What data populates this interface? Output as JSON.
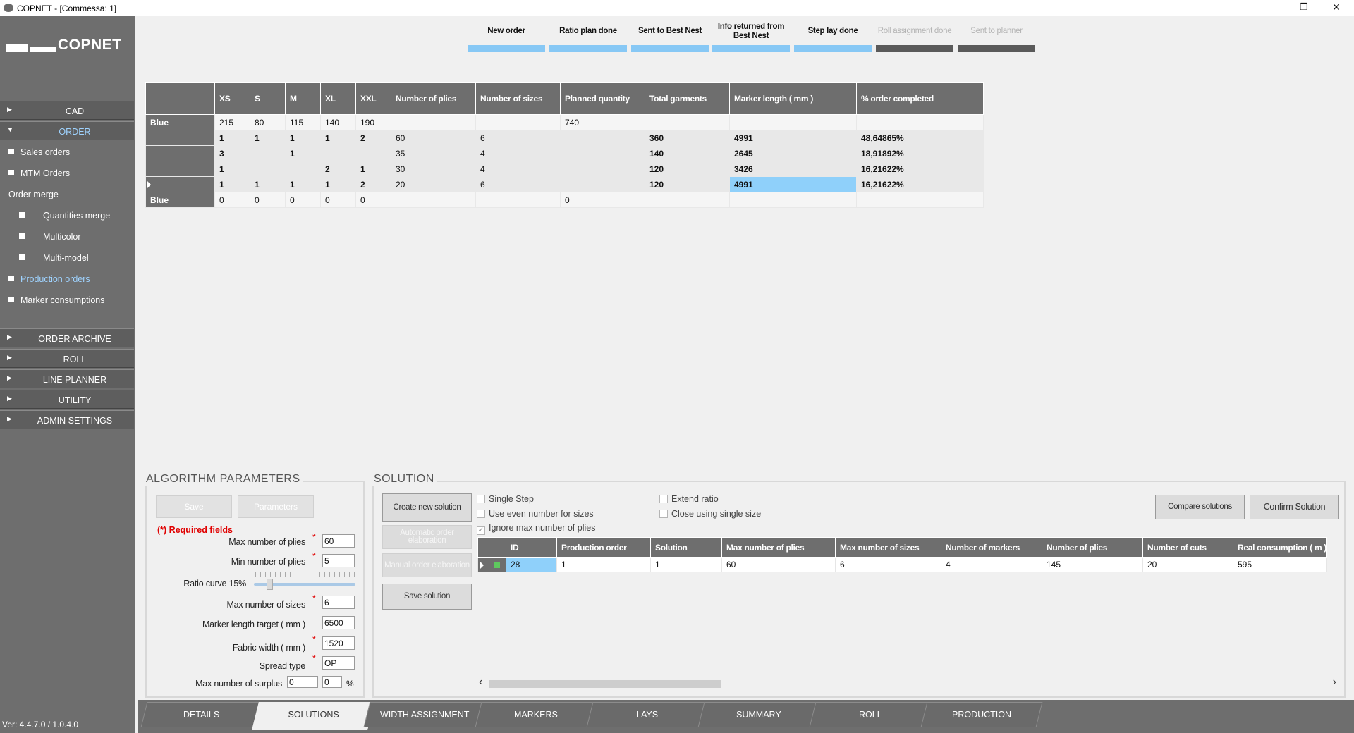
{
  "window": {
    "title": "COPNET - [Commessa: 1]",
    "minimize_icon": "minimize-icon",
    "maximize_icon": "restore-icon",
    "close_icon": "close-icon",
    "minimize_glyph": "—",
    "restore_glyph": "❐",
    "close_glyph": "✕"
  },
  "sidebar": {
    "logo_text": "COPNET",
    "sections_top": [
      {
        "label": "CAD",
        "expanded": false
      },
      {
        "label": "ORDER",
        "expanded": true
      }
    ],
    "order_items": [
      {
        "label": "Sales orders"
      },
      {
        "label": "MTM Orders"
      },
      {
        "label": "Order merge"
      },
      {
        "label": "Quantities merge"
      },
      {
        "label": "Multicolor"
      },
      {
        "label": "Multi-model"
      },
      {
        "label": "Production orders",
        "highlighted": true
      },
      {
        "label": "Marker consumptions"
      }
    ],
    "sections_bottom": [
      {
        "label": "ORDER ARCHIVE"
      },
      {
        "label": "ROLL"
      },
      {
        "label": "LINE PLANNER"
      },
      {
        "label": "UTILITY"
      },
      {
        "label": "ADMIN SETTINGS"
      }
    ],
    "arrow_right": "▶",
    "arrow_down": "▼",
    "version": "Ver: 4.4.7.0 / 1.0.4.0"
  },
  "steps": [
    {
      "label": "New order",
      "done": true
    },
    {
      "label": "Ratio plan done",
      "done": true
    },
    {
      "label": "Sent to Best Nest",
      "done": true
    },
    {
      "label": "Info returned from Best Nest",
      "done": true
    },
    {
      "label": "Step lay done",
      "done": true
    },
    {
      "label": "Roll assignment done",
      "done": false
    },
    {
      "label": "Sent to planner",
      "done": false
    }
  ],
  "order_grid": {
    "columns": [
      "",
      "XS",
      "S",
      "M",
      "XL",
      "XXL",
      "Number of plies",
      "Number of sizes",
      "Planned quantity",
      "Total garments",
      "Marker length ( mm )",
      "% order completed"
    ],
    "rows": [
      [
        "Blue",
        "215",
        "80",
        "115",
        "140",
        "190",
        "",
        "",
        "740",
        "",
        "",
        ""
      ],
      [
        "",
        "1",
        "1",
        "1",
        "1",
        "2",
        "60",
        "6",
        "",
        "360",
        "4991",
        "48,64865%"
      ],
      [
        "",
        "3",
        "",
        "1",
        "",
        "",
        "35",
        "4",
        "",
        "140",
        "2645",
        "18,91892%"
      ],
      [
        "",
        "1",
        "",
        "",
        "2",
        "1",
        "30",
        "4",
        "",
        "120",
        "3426",
        "16,21622%"
      ],
      [
        "",
        "1",
        "1",
        "1",
        "1",
        "2",
        "20",
        "6",
        "",
        "120",
        "4991",
        "16,21622%"
      ],
      [
        "Blue",
        "0",
        "0",
        "0",
        "0",
        "0",
        "",
        "",
        "0",
        "",
        "",
        ""
      ]
    ]
  },
  "algorithm": {
    "title": "ALGORITHM PARAMETERS",
    "save_label": "Save",
    "parameters_label": "Parameters",
    "required_note": "(*) Required fields",
    "required_mark": "*",
    "max_plies_label": "Max number of plies",
    "max_plies": "60",
    "min_plies_label": "Min number of plies",
    "min_plies": "5",
    "ratio_curve_label": "Ratio curve 15%",
    "ratio_curve_value": 0.15,
    "max_sizes_label": "Max number of sizes",
    "max_sizes": "6",
    "marker_length_label": "Marker length target ( mm )",
    "marker_length": "6500",
    "fabric_width_label": "Fabric width ( mm )",
    "fabric_width": "1520",
    "spread_type_label": "Spread type",
    "spread_type": "OP",
    "surplus_label": "Max number of surplus",
    "surplus_a": "0",
    "surplus_b": "0",
    "surplus_unit": "%"
  },
  "solution": {
    "title": "SOLUTION",
    "create_label": "Create new solution",
    "auto_label": "Automatic order elaboration",
    "manual_label": "Manual order elaboration",
    "save_label": "Save solution",
    "compare_label": "Compare solutions",
    "confirm_label": "Confirm Solution",
    "single_step": "Single Step",
    "even_number": "Use even number for sizes",
    "ignore_max": "Ignore max number of plies",
    "extend_ratio": "Extend ratio",
    "close_single": "Close using single size",
    "check_mark": "✓",
    "columns": [
      "",
      "ID",
      "Production order",
      "Solution",
      "Max number of plies",
      "Max number of sizes",
      "Number of markers",
      "Number of plies",
      "Number of cuts",
      "Real consumption ( m )"
    ],
    "rows": [
      [
        "",
        "28",
        "1",
        "1",
        "60",
        "6",
        "4",
        "145",
        "20",
        "595"
      ]
    ],
    "scroll_left": "‹",
    "scroll_right": "›"
  },
  "tabs": [
    "DETAILS",
    "SOLUTIONS",
    "WIDTH ASSIGNMENT",
    "MARKERS",
    "LAYS",
    "SUMMARY",
    "ROLL",
    "PRODUCTION"
  ],
  "active_tab": "SOLUTIONS",
  "colors": {
    "sidebar": "#6e6e6e",
    "accent_blue": "#87c8f5",
    "header_gray": "#6e6e6e",
    "required_red": "#e00000"
  }
}
